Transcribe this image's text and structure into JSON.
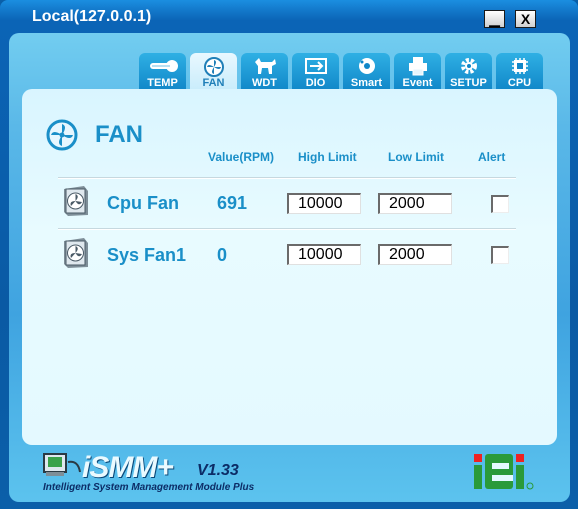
{
  "window": {
    "title": "Local(127.0.0.1)"
  },
  "tabs": [
    {
      "label": "TEMP",
      "icon": "thermometer-icon",
      "active": false
    },
    {
      "label": "FAN",
      "icon": "fan-icon",
      "active": true
    },
    {
      "label": "WDT",
      "icon": "dog-icon",
      "active": false
    },
    {
      "label": "DIO",
      "icon": "dio-icon",
      "active": false
    },
    {
      "label": "Smart",
      "icon": "disk-icon",
      "active": false
    },
    {
      "label": "Event",
      "icon": "printer-icon",
      "active": false
    },
    {
      "label": "SETUP",
      "icon": "gear-icon",
      "active": false
    },
    {
      "label": "CPU",
      "icon": "chip-icon",
      "active": false
    }
  ],
  "page": {
    "title": "FAN",
    "columns": {
      "value": "Value(RPM)",
      "high": "High Limit",
      "low": "Low Limit",
      "alert": "Alert"
    }
  },
  "fans": [
    {
      "name": "Cpu Fan",
      "value": "691",
      "high": "10000",
      "low": "2000",
      "alert": false
    },
    {
      "name": "Sys Fan1",
      "value": "0",
      "high": "10000",
      "low": "2000",
      "alert": false
    }
  ],
  "footer": {
    "brand": "iSMM",
    "plus": "+",
    "version": "V1.33",
    "tagline": "Intelligent System Management Module Plus",
    "vendor_logo": "iEi"
  },
  "colors": {
    "accent": "#1a8fc8",
    "titlebar": "#0a5fa8",
    "content_bg": "#e4f9ff"
  }
}
